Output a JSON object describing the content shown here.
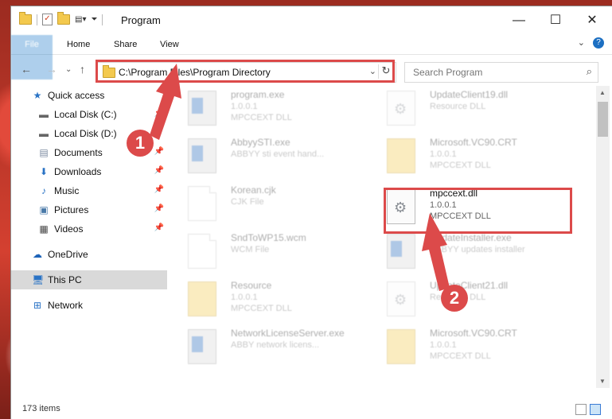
{
  "window": {
    "title": "Program"
  },
  "ribbon": {
    "tabs": [
      "File",
      "Home",
      "Share",
      "View"
    ]
  },
  "address": {
    "path": "C:\\Program Files\\Program Directory"
  },
  "search": {
    "placeholder": "Search Program"
  },
  "sidebar": {
    "items": [
      {
        "label": "Quick access",
        "icon": "star-icon"
      },
      {
        "label": "Local Disk (C:)",
        "icon": "drive-icon"
      },
      {
        "label": "Local Disk (D:)",
        "icon": "drive-icon"
      },
      {
        "label": "Documents",
        "icon": "documents-icon"
      },
      {
        "label": "Downloads",
        "icon": "download-icon"
      },
      {
        "label": "Music",
        "icon": "music-icon"
      },
      {
        "label": "Pictures",
        "icon": "pictures-icon"
      },
      {
        "label": "Videos",
        "icon": "videos-icon"
      },
      {
        "label": "OneDrive",
        "icon": "cloud-icon"
      },
      {
        "label": "This PC",
        "icon": "computer-icon"
      },
      {
        "label": "Network",
        "icon": "network-icon"
      }
    ]
  },
  "files": [
    {
      "name": "program.exe",
      "line2": "1.0.0.1",
      "line3": "MPCCEXT DLL",
      "icon": "program-exe-icon"
    },
    {
      "name": "UpdateClient19.dll",
      "line2": "Resource DLL",
      "line3": "",
      "icon": "dll-icon"
    },
    {
      "name": "AbbyySTI.exe",
      "line2": "ABBYY sti event hand...",
      "line3": "",
      "icon": "exe-icon"
    },
    {
      "name": "Microsoft.VC90.CRT",
      "line2": "1.0.0.1",
      "line3": "MPCCEXT DLL",
      "icon": "folder-icon"
    },
    {
      "name": "Korean.cjk",
      "line2": "CJK File",
      "line3": "",
      "icon": "file-icon"
    },
    {
      "name": "mpccext.dll",
      "line2": "1.0.0.1",
      "line3": "MPCCEXT DLL",
      "icon": "dll-icon"
    },
    {
      "name": "SndToWP15.wcm",
      "line2": "WCM File",
      "line3": "",
      "icon": "file-icon"
    },
    {
      "name": "UpdateInstaller.exe",
      "line2": "ABBYY updates installer",
      "line3": "",
      "icon": "exe-icon"
    },
    {
      "name": "Resource",
      "line2": "1.0.0.1",
      "line3": "MPCCEXT DLL",
      "icon": "folder-icon"
    },
    {
      "name": "UpdateClient21.dll",
      "line2": "Resource DLL",
      "line3": "",
      "icon": "dll-icon"
    },
    {
      "name": "NetworkLicenseServer.exe",
      "line2": "ABBY network licens...",
      "line3": "",
      "icon": "exe-icon"
    },
    {
      "name": "Microsoft.VC90.CRT",
      "line2": "1.0.0.1",
      "line3": "MPCCEXT DLL",
      "icon": "folder-icon"
    }
  ],
  "status": {
    "item_count": "173 items"
  },
  "callouts": [
    "1",
    "2"
  ],
  "colors": {
    "accent": "#1979ca",
    "highlight": "#dc4a4a"
  }
}
